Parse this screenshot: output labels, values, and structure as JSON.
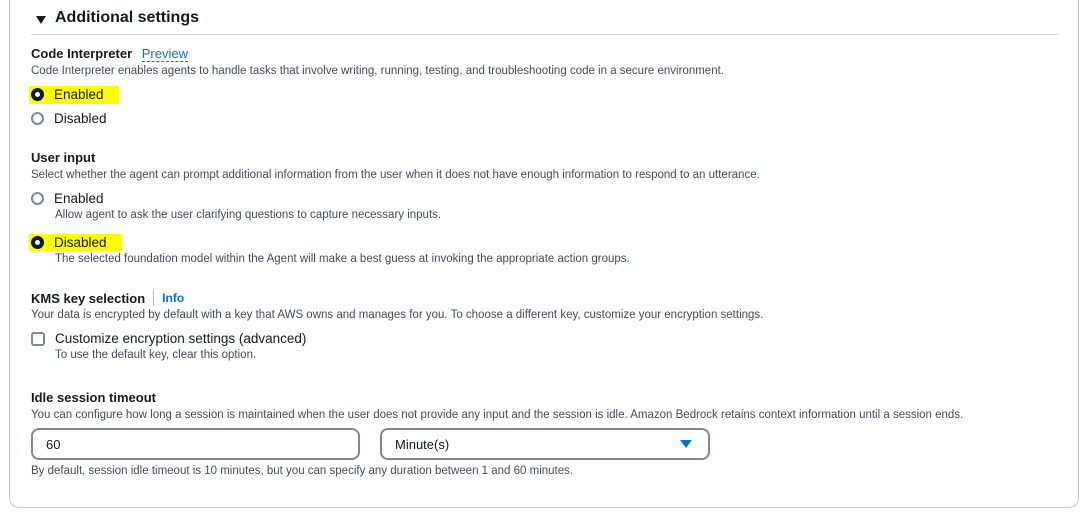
{
  "header": {
    "title": "Additional settings"
  },
  "code_interpreter": {
    "title": "Code Interpreter",
    "badge": "Preview",
    "description": "Code Interpreter enables agents to handle tasks that involve writing, running, testing, and troubleshooting code in a secure environment.",
    "options": [
      {
        "label": "Enabled",
        "selected": true
      },
      {
        "label": "Disabled",
        "selected": false
      }
    ]
  },
  "user_input": {
    "title": "User input",
    "description": "Select whether the agent can prompt additional information from the user when it does not have enough information to respond to an utterance.",
    "options": [
      {
        "label": "Enabled",
        "hint": "Allow agent to ask the user clarifying questions to capture necessary inputs.",
        "selected": false
      },
      {
        "label": "Disabled",
        "hint": "The selected foundation model within the Agent will make a best guess at invoking the appropriate action groups.",
        "selected": true
      }
    ]
  },
  "kms": {
    "title": "KMS key selection",
    "info": "Info",
    "description": "Your data is encrypted by default with a key that AWS owns and manages for you. To choose a different key, customize your encryption settings.",
    "checkbox_label": "Customize encryption settings (advanced)",
    "checkbox_hint": "To use the default key, clear this option.",
    "checked": false
  },
  "idle": {
    "title": "Idle session timeout",
    "description": "You can configure how long a session is maintained when the user does not provide any input and the session is idle. Amazon Bedrock retains context information until a session ends.",
    "value": "60",
    "unit": "Minute(s)",
    "hint": "By default, session idle timeout is 10 minutes, but you can specify any duration between 1 and 60 minutes."
  },
  "colors": {
    "highlight": "#fffb00",
    "link": "#0972d3",
    "text": "#16191f",
    "secondary": "#414d5c"
  }
}
